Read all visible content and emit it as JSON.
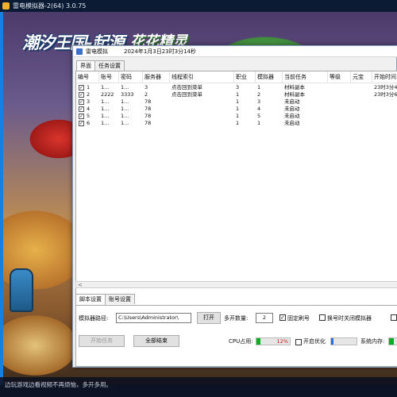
{
  "background_app": {
    "title": "雷电模拟器-2(64) 3.0.75",
    "logo_left": "潮汐王国-起源",
    "logo_sep": "×",
    "logo_right": "花花精灵",
    "footer_text": "边玩游戏边看视频不再烦恼，多开多用。"
  },
  "tool_window": {
    "title": "雷电模拟",
    "timestamp": "2024年1月3日23时3分14秒",
    "tabs": [
      "界面",
      "任务设置"
    ],
    "table": {
      "columns": [
        "编号",
        "账号",
        "密码",
        "服务器",
        "线程索引",
        "职业",
        "模拟器",
        "当前任务",
        "等级",
        "元宝",
        "开始时间"
      ],
      "rows": [
        {
          "checked": "✓",
          "id": "1",
          "account": "1...",
          "password": "1...",
          "server": "3",
          "thread": "点击回到菜单",
          "job": "3",
          "emulator": "1",
          "task": "材料副本",
          "level": "",
          "yuanbao": "",
          "start": "23时3分4"
        },
        {
          "checked": "✓",
          "id": "2",
          "account": "2222",
          "password": "3333",
          "server": "2",
          "thread": "点击回到菜单",
          "job": "1",
          "emulator": "2",
          "task": "材料副本",
          "level": "",
          "yuanbao": "",
          "start": "23时3分6"
        },
        {
          "checked": "✓",
          "id": "3",
          "account": "1...",
          "password": "1...",
          "server": "78",
          "thread": "",
          "job": "1",
          "emulator": "3",
          "task": "未启动",
          "level": "",
          "yuanbao": "",
          "start": ""
        },
        {
          "checked": "✓",
          "id": "4",
          "account": "1...",
          "password": "1...",
          "server": "78",
          "thread": "",
          "job": "1",
          "emulator": "4",
          "task": "未启动",
          "level": "",
          "yuanbao": "",
          "start": ""
        },
        {
          "checked": "✓",
          "id": "5",
          "account": "1...",
          "password": "1...",
          "server": "78",
          "thread": "",
          "job": "1",
          "emulator": "5",
          "task": "未启动",
          "level": "",
          "yuanbao": "",
          "start": ""
        },
        {
          "checked": "✓",
          "id": "6",
          "account": "1...",
          "password": "1...",
          "server": "78",
          "thread": "",
          "job": "1",
          "emulator": "1",
          "task": "未启动",
          "level": "",
          "yuanbao": "",
          "start": ""
        }
      ]
    },
    "scroll_left_arrow": "<",
    "bottom_tabs": [
      "脚本设置",
      "账号设置"
    ],
    "settings": {
      "emulator_path_label": "模拟器路径:",
      "emulator_path_value": "C:\\Users\\Administrator\\",
      "open_button": "打开",
      "multi_count_label": "多开数量:",
      "multi_count_value": "2",
      "fixed_refresh_label": "固定刷号",
      "fixed_refresh_checked": "✓",
      "close_on_switch_label": "换号时关闭模拟器",
      "start_task_button": "开始任务",
      "end_all_button": "全部结束",
      "cpu_label": "CPU占用:",
      "cpu_value": "12%",
      "cpu_fraction": 0.12,
      "optimize_label": "开启优化",
      "memory_label": "系统内存:"
    }
  }
}
